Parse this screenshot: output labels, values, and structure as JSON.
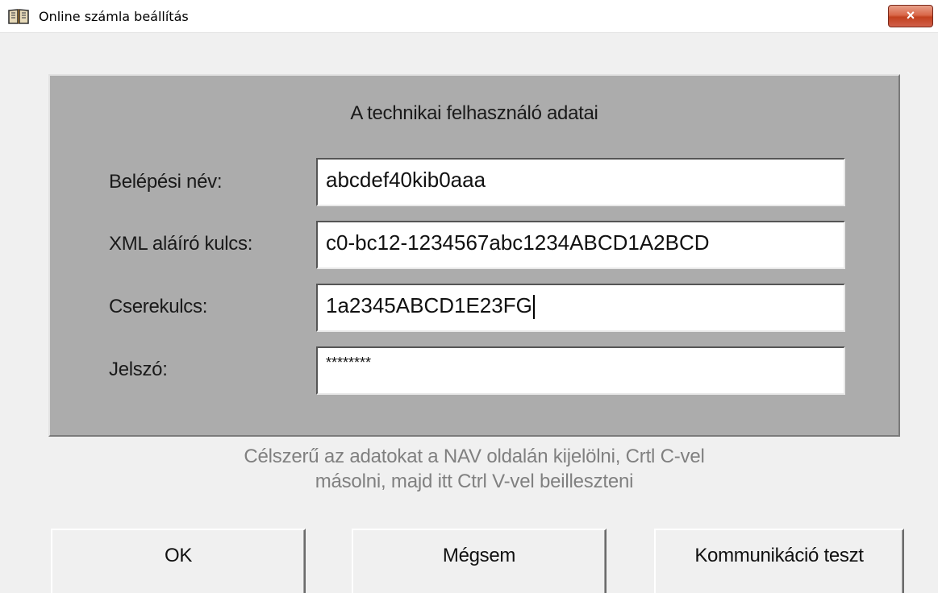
{
  "window": {
    "title": "Online számla beállítás",
    "close_label": "×",
    "app_icon": "open-book-icon"
  },
  "panel": {
    "heading": "A technikai felhasználó adatai",
    "fields": [
      {
        "label": "Belépési név:",
        "value": "abcdef40kib0aaa"
      },
      {
        "label": "XML aláíró kulcs:",
        "value": "c0-bc12-1234567abc1234ABCD1A2BCD"
      },
      {
        "label": "Cserekulcs:",
        "value": "1a2345ABCD1E23FG"
      },
      {
        "label": "Jelszó:",
        "value": "********"
      }
    ]
  },
  "hint": {
    "line1": "Célszerű az adatokat a NAV oldalán kijelölni, Crtl C-vel",
    "line2": "másolni, majd itt Ctrl V-vel beilleszteni"
  },
  "buttons": {
    "ok": "OK",
    "cancel": "Mégsem",
    "test": "Kommunikáció teszt"
  }
}
